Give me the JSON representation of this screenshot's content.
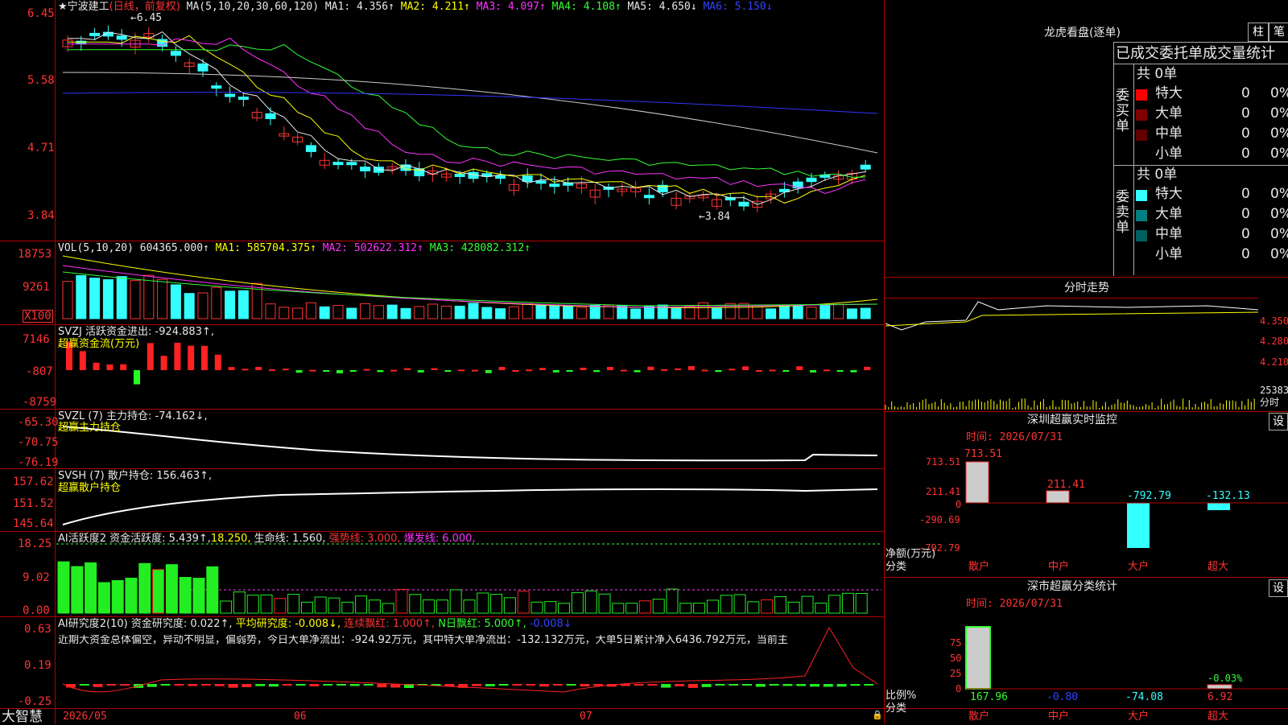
{
  "colors": {
    "up": "#ff3333",
    "down": "#33ffff",
    "grid": "#b00000",
    "yellow": "#ffff00",
    "magenta": "#ff33ff",
    "green": "#33ff33",
    "blue": "#3333ff",
    "white": "#e8e8e8"
  },
  "main": {
    "title_star": "★",
    "stock_name": "宁波建工",
    "period": "(日线，前复权)",
    "ma_legend": "MA(5,10,20,30,60,120)",
    "ma1": "MA1: 4.356↑",
    "ma2": "MA2: 4.211↑",
    "ma3": "MA3: 4.097↑",
    "ma4": "MA4: 4.108↑",
    "ma5": "MA5: 4.650↓",
    "ma6": "MA6: 5.150↓",
    "high_marker": "←6.45",
    "low_marker": "←3.84",
    "y_ticks": [
      "6.45",
      "5.58",
      "4.71",
      "3.84"
    ]
  },
  "vol": {
    "legend": "VOL(5,10,20)",
    "value": "604365.000↑",
    "ma1": "MA1: 585704.375↑",
    "ma2": "MA2: 502622.312↑",
    "ma3": "MA3: 428082.312↑",
    "y_ticks": [
      "18753",
      "9261"
    ],
    "unit": "X100"
  },
  "svzj": {
    "legend": "SVZJ  活跃资金进出: -924.883↑,",
    "sub": "超赢资金流(万元)",
    "y_ticks": [
      "7146",
      "-807",
      "-8759"
    ]
  },
  "svzl": {
    "legend": "SVZL (7) 主力持仓: -74.162↓,",
    "sub": "超赢主力持仓",
    "y_ticks": [
      "-65.30",
      "-70.75",
      "-76.19"
    ]
  },
  "svsh": {
    "legend": "SVSH (7) 散户持仓: 156.463↑,",
    "sub": "超赢散户持仓",
    "y_ticks": [
      "157.62",
      "151.52",
      "145.64"
    ]
  },
  "ai2": {
    "legend1": "AI活跃度2 资金活跃度: 5.439↑,",
    "l2": "18.250,",
    "l3": "生命线: 1.560,",
    "l4": "强势线: 3.000,",
    "l5": "爆发线: 6.000,",
    "y_ticks": [
      "18.25",
      "9.02",
      "0.00"
    ]
  },
  "ai_res": {
    "legend1": "AI研究度2(10) 资金研究度: 0.022↑,",
    "l2": "平均研究度: -0.008↓,",
    "l3": "连续飘红: 1.000↑,",
    "l4": "N日飘红: 5.000↑,",
    "l5": "-0.008↓",
    "comment": "近期大资金总体偏空，异动不明显，偏弱势，今日大单净流出：-924.92万元，其中特大单净流出：-132.132万元，大单5日累计净入6436.792万元，当前主",
    "y_ticks": [
      "0.63",
      "0.19",
      "-0.25"
    ]
  },
  "bottom": {
    "brand": "大智慧",
    "dates": [
      "2026/05",
      "06",
      "07"
    ]
  },
  "right": {
    "header": "龙虎看盘(逐单)",
    "btn_bar": "柱",
    "btn_note": "笔",
    "stats_title": "已成交委托单成交量统计",
    "buy": {
      "side": "委买单",
      "total": "共 0单",
      "rows": [
        {
          "label": "特大",
          "v": "0",
          "p": "0%"
        },
        {
          "label": "大单",
          "v": "0",
          "p": "0%"
        },
        {
          "label": "中单",
          "v": "0",
          "p": "0%"
        },
        {
          "label": "小单",
          "v": "0",
          "p": "0%"
        }
      ]
    },
    "sell": {
      "side": "委卖单",
      "total": "共 0单",
      "rows": [
        {
          "label": "特大",
          "v": "0",
          "p": "0%"
        },
        {
          "label": "大单",
          "v": "0",
          "p": "0%"
        },
        {
          "label": "中单",
          "v": "0",
          "p": "0%"
        },
        {
          "label": "小单",
          "v": "0",
          "p": "0%"
        }
      ]
    },
    "intraday_title": "分时走势",
    "intraday_ticks": [
      "4.350",
      "4.280",
      "4.210",
      "25383"
    ],
    "intraday_unit": "分时",
    "monitor_title": "深圳超赢实时监控",
    "monitor_btn": "设",
    "monitor_time": "时间: 2026/07/31",
    "monitor_ticks": [
      "713.51",
      "211.41",
      "0",
      "-290.69",
      "-792.79"
    ],
    "monitor_values": [
      "713.51",
      "211.41",
      "-792.79",
      "-132.13"
    ],
    "monitor_unit": "净额(万元)",
    "cat_label": "分类",
    "categories": [
      "散户",
      "中户",
      "大户",
      "超大"
    ],
    "class_title": "深市超赢分类统计",
    "class_btn": "设",
    "class_time": "时间: 2026/07/31",
    "class_ticks": [
      "75",
      "50",
      "25",
      "0"
    ],
    "class_values": [
      "167.96",
      "-0.80",
      "-74.08",
      "6.92"
    ],
    "class_small": "-0.03%",
    "ratio_label": "比例%"
  }
}
